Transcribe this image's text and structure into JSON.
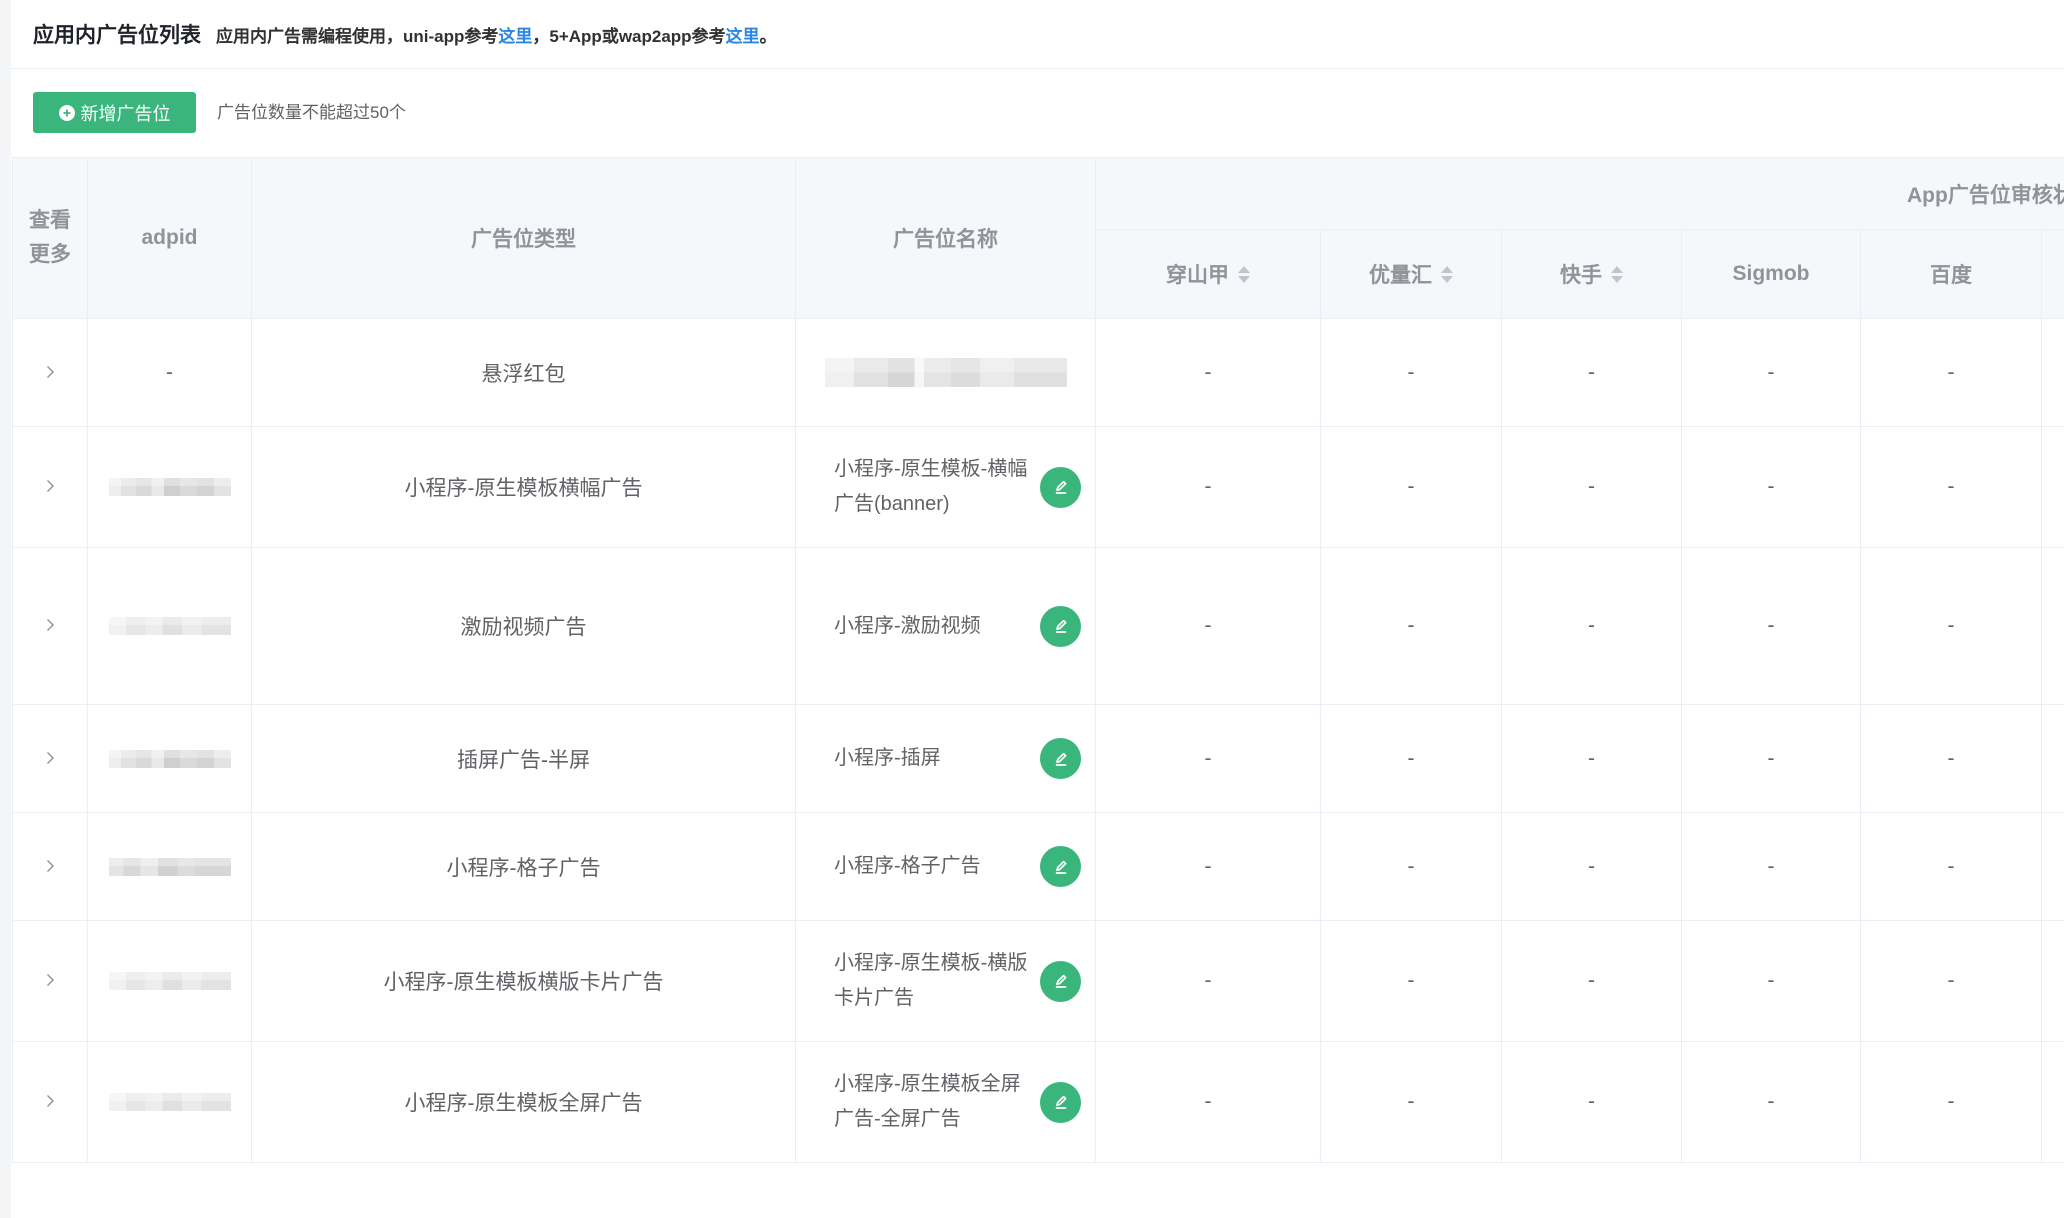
{
  "header": {
    "title": "应用内广告位列表",
    "note": {
      "prefix": "应用内广告需编程使用，uni-app参考",
      "link1": "这里",
      "middle": "，5+App或wap2app参考",
      "link2": "这里",
      "suffix": "。"
    }
  },
  "toolbar": {
    "add_button_label": "新增广告位",
    "add_button_icon": "plus-circle-icon",
    "limit_note": "广告位数量不能超过50个"
  },
  "colors": {
    "accent": "#3ab57c",
    "link": "#2b85e4",
    "header_bg": "#f5f7fa",
    "border": "#ebeef5",
    "header_text": "#909399",
    "body_text": "#606266"
  },
  "table": {
    "expand_icon": "chevron-right-icon",
    "edit_icon": "edit-pencil-icon",
    "sort_icon": "sort-caret-icon",
    "columns": {
      "expand": "查看更多",
      "adpid": "adpid",
      "type": "广告位类型",
      "name": "广告位名称",
      "review_group": "App广告位审核状",
      "review": [
        {
          "label": "穿山甲",
          "sortable": true
        },
        {
          "label": "优量汇",
          "sortable": true
        },
        {
          "label": "快手",
          "sortable": true
        },
        {
          "label": "Sigmob",
          "sortable": false
        },
        {
          "label": "百度",
          "sortable": false
        }
      ]
    },
    "rows": [
      {
        "adpid": "-",
        "type": "悬浮红包",
        "review": [
          "-",
          "-",
          "-",
          "-",
          "-"
        ]
      },
      {
        "type": "小程序-原生模板横幅广告",
        "name_lines": [
          "小程序-原生模板-横幅",
          "广告(banner)"
        ],
        "review": [
          "-",
          "-",
          "-",
          "-",
          "-"
        ]
      },
      {
        "type": "激励视频广告",
        "name_lines": [
          "小程序-激励视频"
        ],
        "review": [
          "-",
          "-",
          "-",
          "-",
          "-"
        ]
      },
      {
        "type": "插屏广告-半屏",
        "name_lines": [
          "小程序-插屏"
        ],
        "review": [
          "-",
          "-",
          "-",
          "-",
          "-"
        ]
      },
      {
        "type": "小程序-格子广告",
        "name_lines": [
          "小程序-格子广告"
        ],
        "review": [
          "-",
          "-",
          "-",
          "-",
          "-"
        ]
      },
      {
        "type": "小程序-原生模板横版卡片广告",
        "name_lines": [
          "小程序-原生模板-横版",
          "卡片广告"
        ],
        "review": [
          "-",
          "-",
          "-",
          "-",
          "-"
        ]
      },
      {
        "type": "小程序-原生模板全屏广告",
        "name_lines": [
          "小程序-原生模板全屏",
          "广告-全屏广告"
        ],
        "review": [
          "-",
          "-",
          "-",
          "-",
          "-"
        ]
      }
    ]
  }
}
